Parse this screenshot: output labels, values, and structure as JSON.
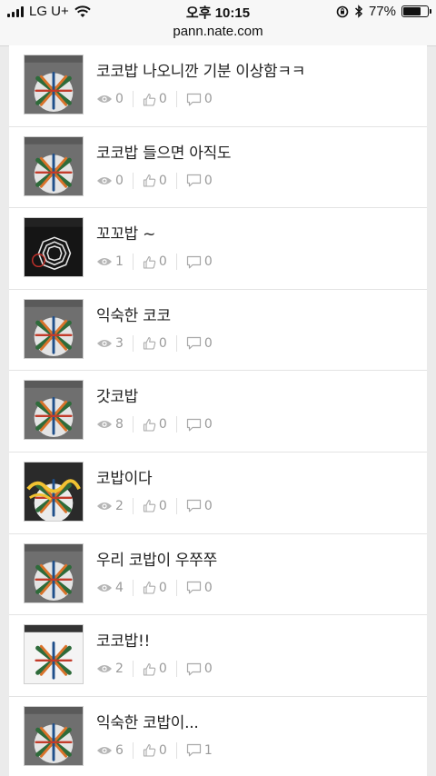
{
  "status_bar": {
    "carrier": "LG U+",
    "time": "오후 10:15",
    "battery": "77%",
    "battery_level": 0.77
  },
  "browser": {
    "url": "pann.nate.com"
  },
  "posts": [
    {
      "title": "코코밥 나오니깐 기분 이상함ㅋㅋ",
      "views": "0",
      "likes": "0",
      "comments": "0",
      "thumb": "album-gray"
    },
    {
      "title": "코코밥 들으면 아직도",
      "views": "0",
      "likes": "0",
      "comments": "0",
      "thumb": "album-gray"
    },
    {
      "title": "꼬꼬밥 ~",
      "views": "1",
      "likes": "0",
      "comments": "0",
      "thumb": "exo-dark-logo"
    },
    {
      "title": "익숙한 코코",
      "views": "3",
      "likes": "0",
      "comments": "0",
      "thumb": "album-gray"
    },
    {
      "title": "갓코밥",
      "views": "8",
      "likes": "0",
      "comments": "0",
      "thumb": "album-gray"
    },
    {
      "title": "코밥이다",
      "views": "2",
      "likes": "0",
      "comments": "0",
      "thumb": "album-dark-doodle"
    },
    {
      "title": "우리 코밥이 우쭈쭈",
      "views": "4",
      "likes": "0",
      "comments": "0",
      "thumb": "album-gray"
    },
    {
      "title": "코코밥!!",
      "views": "2",
      "likes": "0",
      "comments": "0",
      "thumb": "album-white"
    },
    {
      "title": "익숙한 코밥이...",
      "views": "6",
      "likes": "0",
      "comments": "1",
      "thumb": "album-gray"
    }
  ]
}
